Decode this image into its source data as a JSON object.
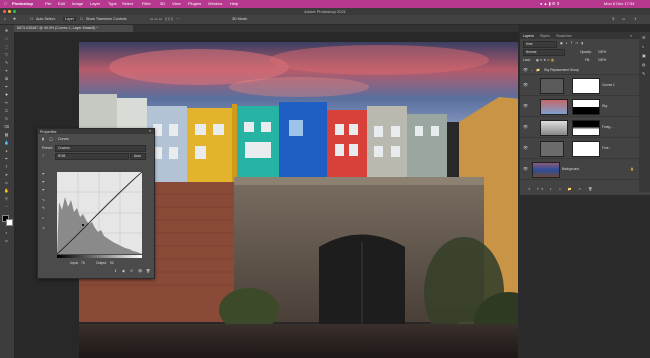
{
  "menubar": {
    "app": "Photoshop",
    "items": [
      "File",
      "Edit",
      "Image",
      "Layer",
      "Type",
      "Select",
      "Filter",
      "3D",
      "View",
      "Plugins",
      "Window",
      "Help"
    ],
    "clock": "Mon 6 Dec 17:34"
  },
  "window": {
    "title": "Adobe Photoshop 2021"
  },
  "options_bar": {
    "auto_select": "Auto-Select:",
    "auto_select_value": "Layer",
    "show_transform": "Show Transform Controls"
  },
  "document_tab": {
    "label": "6873-035487 @ 49.9% (Curves 1, Layer Mask/8) *"
  },
  "toolbar": {
    "tools": [
      "move",
      "artboard",
      "marquee",
      "lasso",
      "quick-select",
      "crop",
      "frame",
      "eyedropper",
      "heal",
      "brush",
      "stamp",
      "history",
      "eraser",
      "gradient",
      "blur",
      "dodge",
      "pen",
      "type",
      "path-select",
      "rectangle",
      "hand",
      "zoom"
    ]
  },
  "properties": {
    "tab": "Properties",
    "type_label": "Curves",
    "preset_label": "Preset:",
    "preset_value": "Custom",
    "channel_value": "RGB",
    "auto_button": "Auto",
    "input_label": "Input:",
    "input_value": "76",
    "output_label": "Output:",
    "output_value": "92"
  },
  "layers_panel": {
    "tabs": [
      "Layers",
      "Styles",
      "Swatches"
    ],
    "kind": "Kind",
    "blend_mode": "Normal",
    "opacity_label": "Opacity:",
    "opacity_value": "100%",
    "lock_label": "Lock:",
    "fill_label": "Fill:",
    "fill_value": "100%",
    "group_name": "Sky Replacement Group",
    "layers": [
      {
        "name": "Curves 1"
      },
      {
        "name": "Sky"
      },
      {
        "name": "Foreg..."
      },
      {
        "name": "Fore..."
      },
      {
        "name": "Background"
      }
    ]
  },
  "colors": {
    "menubar": "#b7398f",
    "panel": "#434343",
    "panel_dark": "#323232",
    "accent": "#3b6fd6"
  }
}
